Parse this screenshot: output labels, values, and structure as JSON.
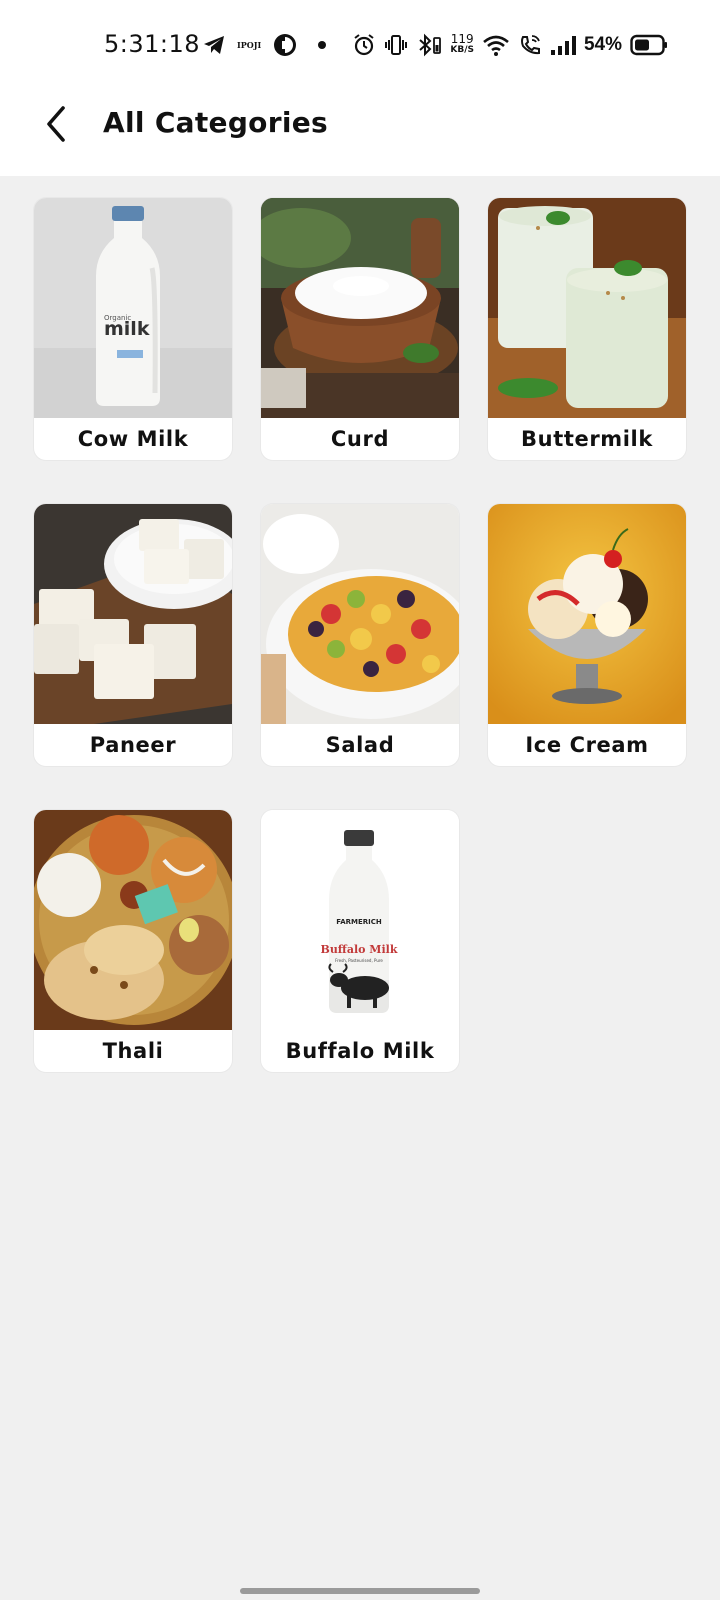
{
  "status_bar": {
    "time": "5:31:18",
    "small_icon_text": "IPOJI",
    "net_speed_value": "119",
    "net_speed_unit": "KB/S",
    "battery_percent": "54%"
  },
  "header": {
    "title": "All Categories"
  },
  "categories": [
    {
      "label": "Cow Milk",
      "image": "milk-bottle-image"
    },
    {
      "label": "Curd",
      "image": "curd-bowl-image"
    },
    {
      "label": "Buttermilk",
      "image": "buttermilk-glasses-image"
    },
    {
      "label": "Paneer",
      "image": "paneer-cubes-image"
    },
    {
      "label": "Salad",
      "image": "fruit-salad-image"
    },
    {
      "label": "Ice Cream",
      "image": "ice-cream-sundae-image"
    },
    {
      "label": "Thali",
      "image": "thali-platter-image"
    },
    {
      "label": "Buffalo Milk",
      "image": "buffalo-milk-bottle-image"
    }
  ],
  "image_text": {
    "cow_milk_bottle_brand": "milk",
    "cow_milk_bottle_sub": "Organic",
    "buffalo_bottle_brand": "FARMERICH",
    "buffalo_bottle_product": "Buffalo Milk",
    "buffalo_bottle_tagline": "Fresh, Pasteurised, Pure"
  },
  "colors": {
    "background": "#f0f0f0",
    "card": "#ffffff",
    "text": "#111111"
  }
}
